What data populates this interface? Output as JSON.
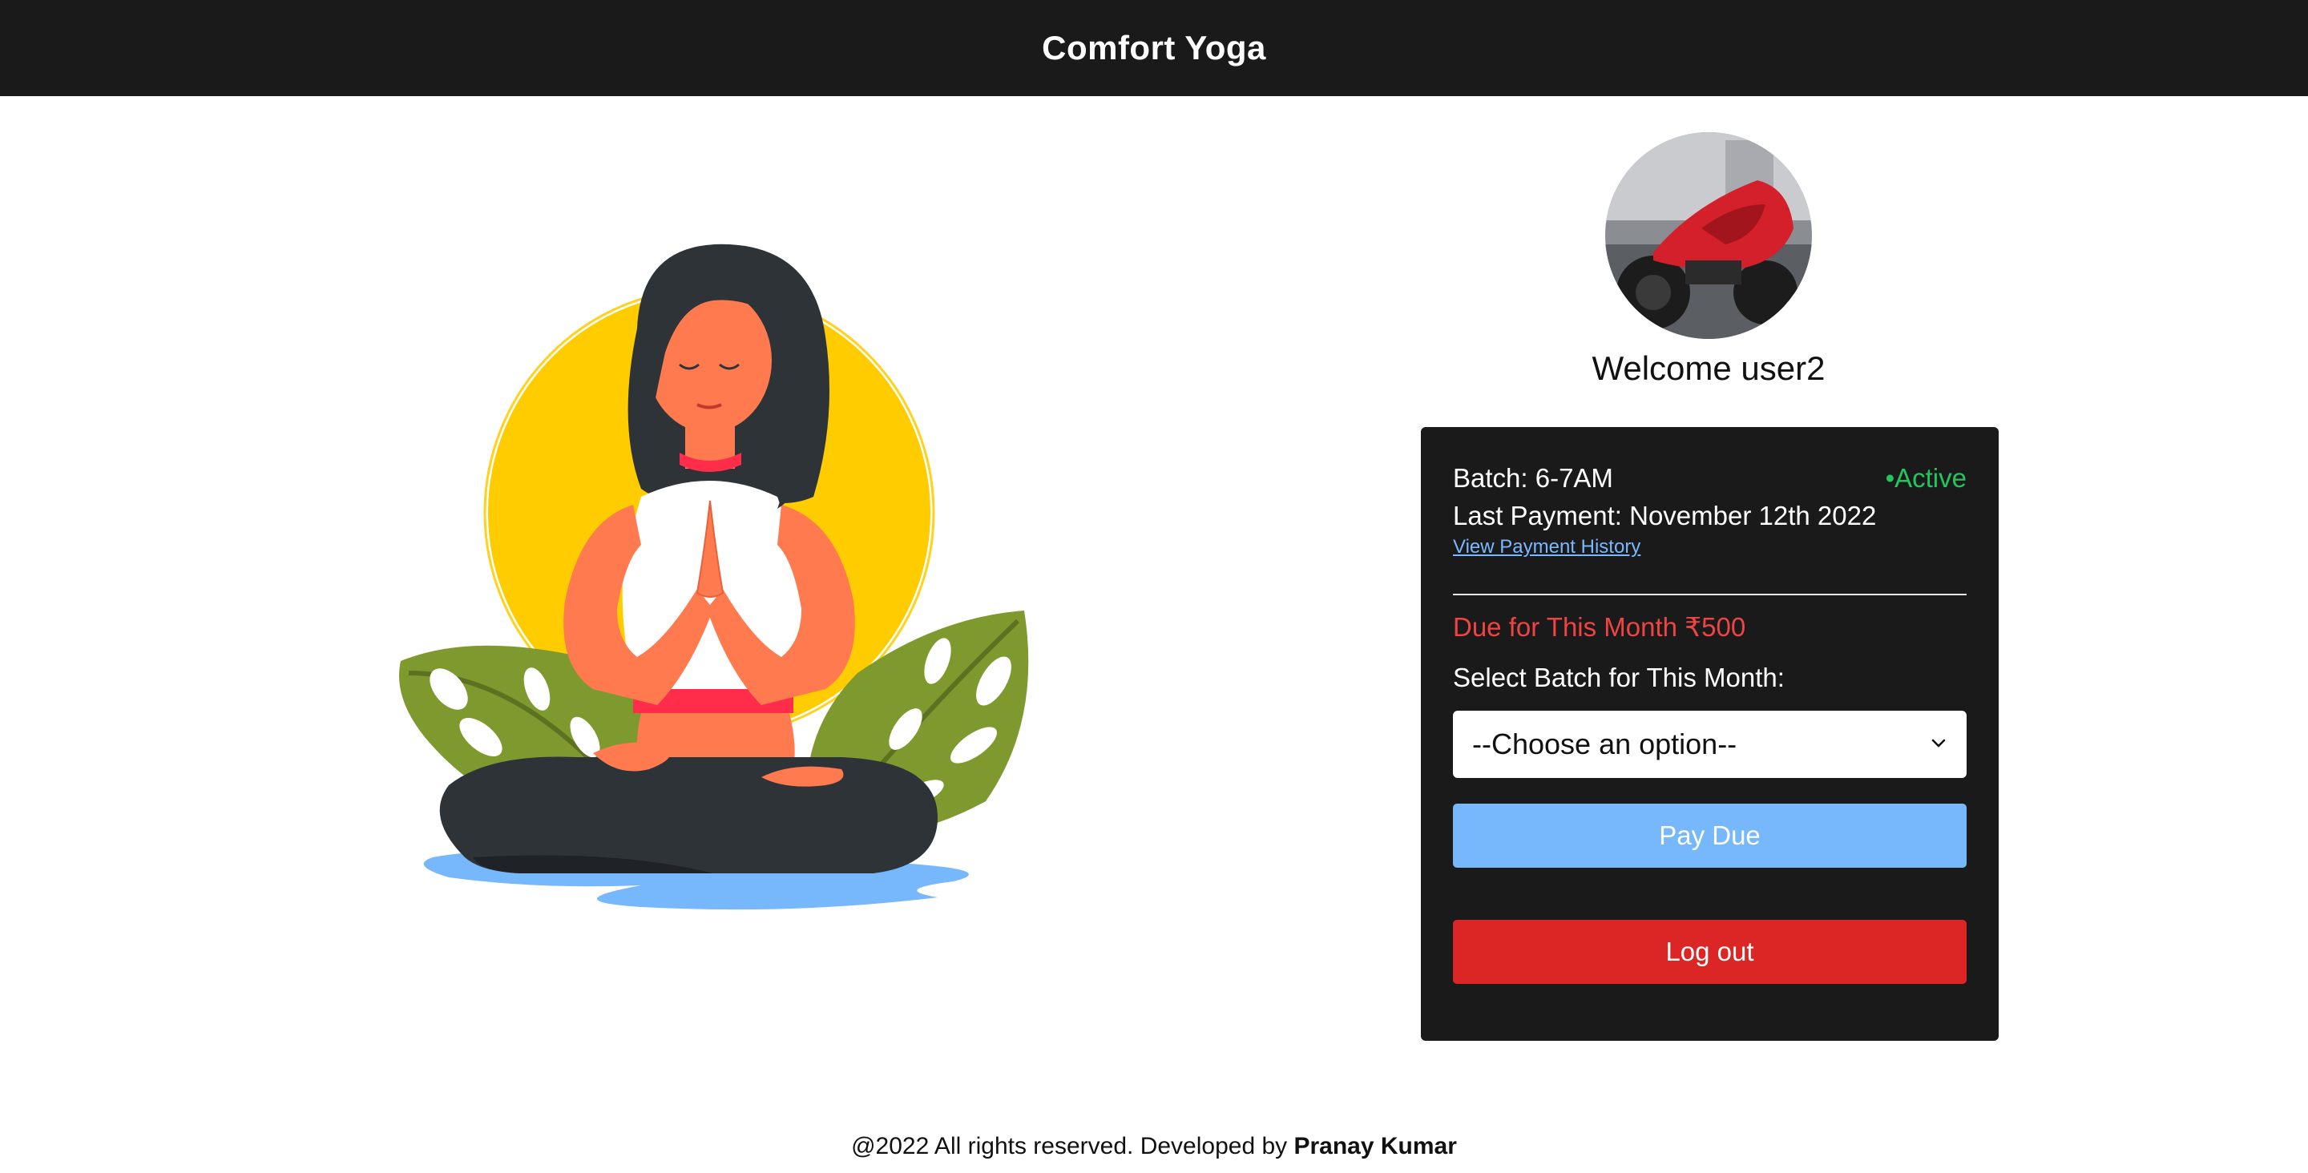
{
  "header": {
    "title": "Comfort Yoga"
  },
  "user": {
    "welcome": "Welcome user2"
  },
  "card": {
    "batch": "Batch: 6-7AM",
    "status": "•Active",
    "last_payment": "Last Payment: November 12th 2022",
    "history_link": "View Payment History",
    "due": "Due for This Month ₹500",
    "select_label": "Select Batch for This Month:",
    "select_value": "--Choose an option--",
    "pay_button": "Pay Due",
    "logout_button": "Log out"
  },
  "footer": {
    "text": "@2022 All rights reserved. Developed by ",
    "author": "Pranay Kumar"
  },
  "colors": {
    "navbar": "#1a1a1a",
    "active": "#22c55e",
    "due": "#ef4444",
    "pay": "#76b8fb",
    "logout": "#dc2626",
    "link": "#7ab8ff"
  },
  "icons": {
    "select_chevron": "chevron-down-icon",
    "avatar": "motorcycle-avatar"
  }
}
